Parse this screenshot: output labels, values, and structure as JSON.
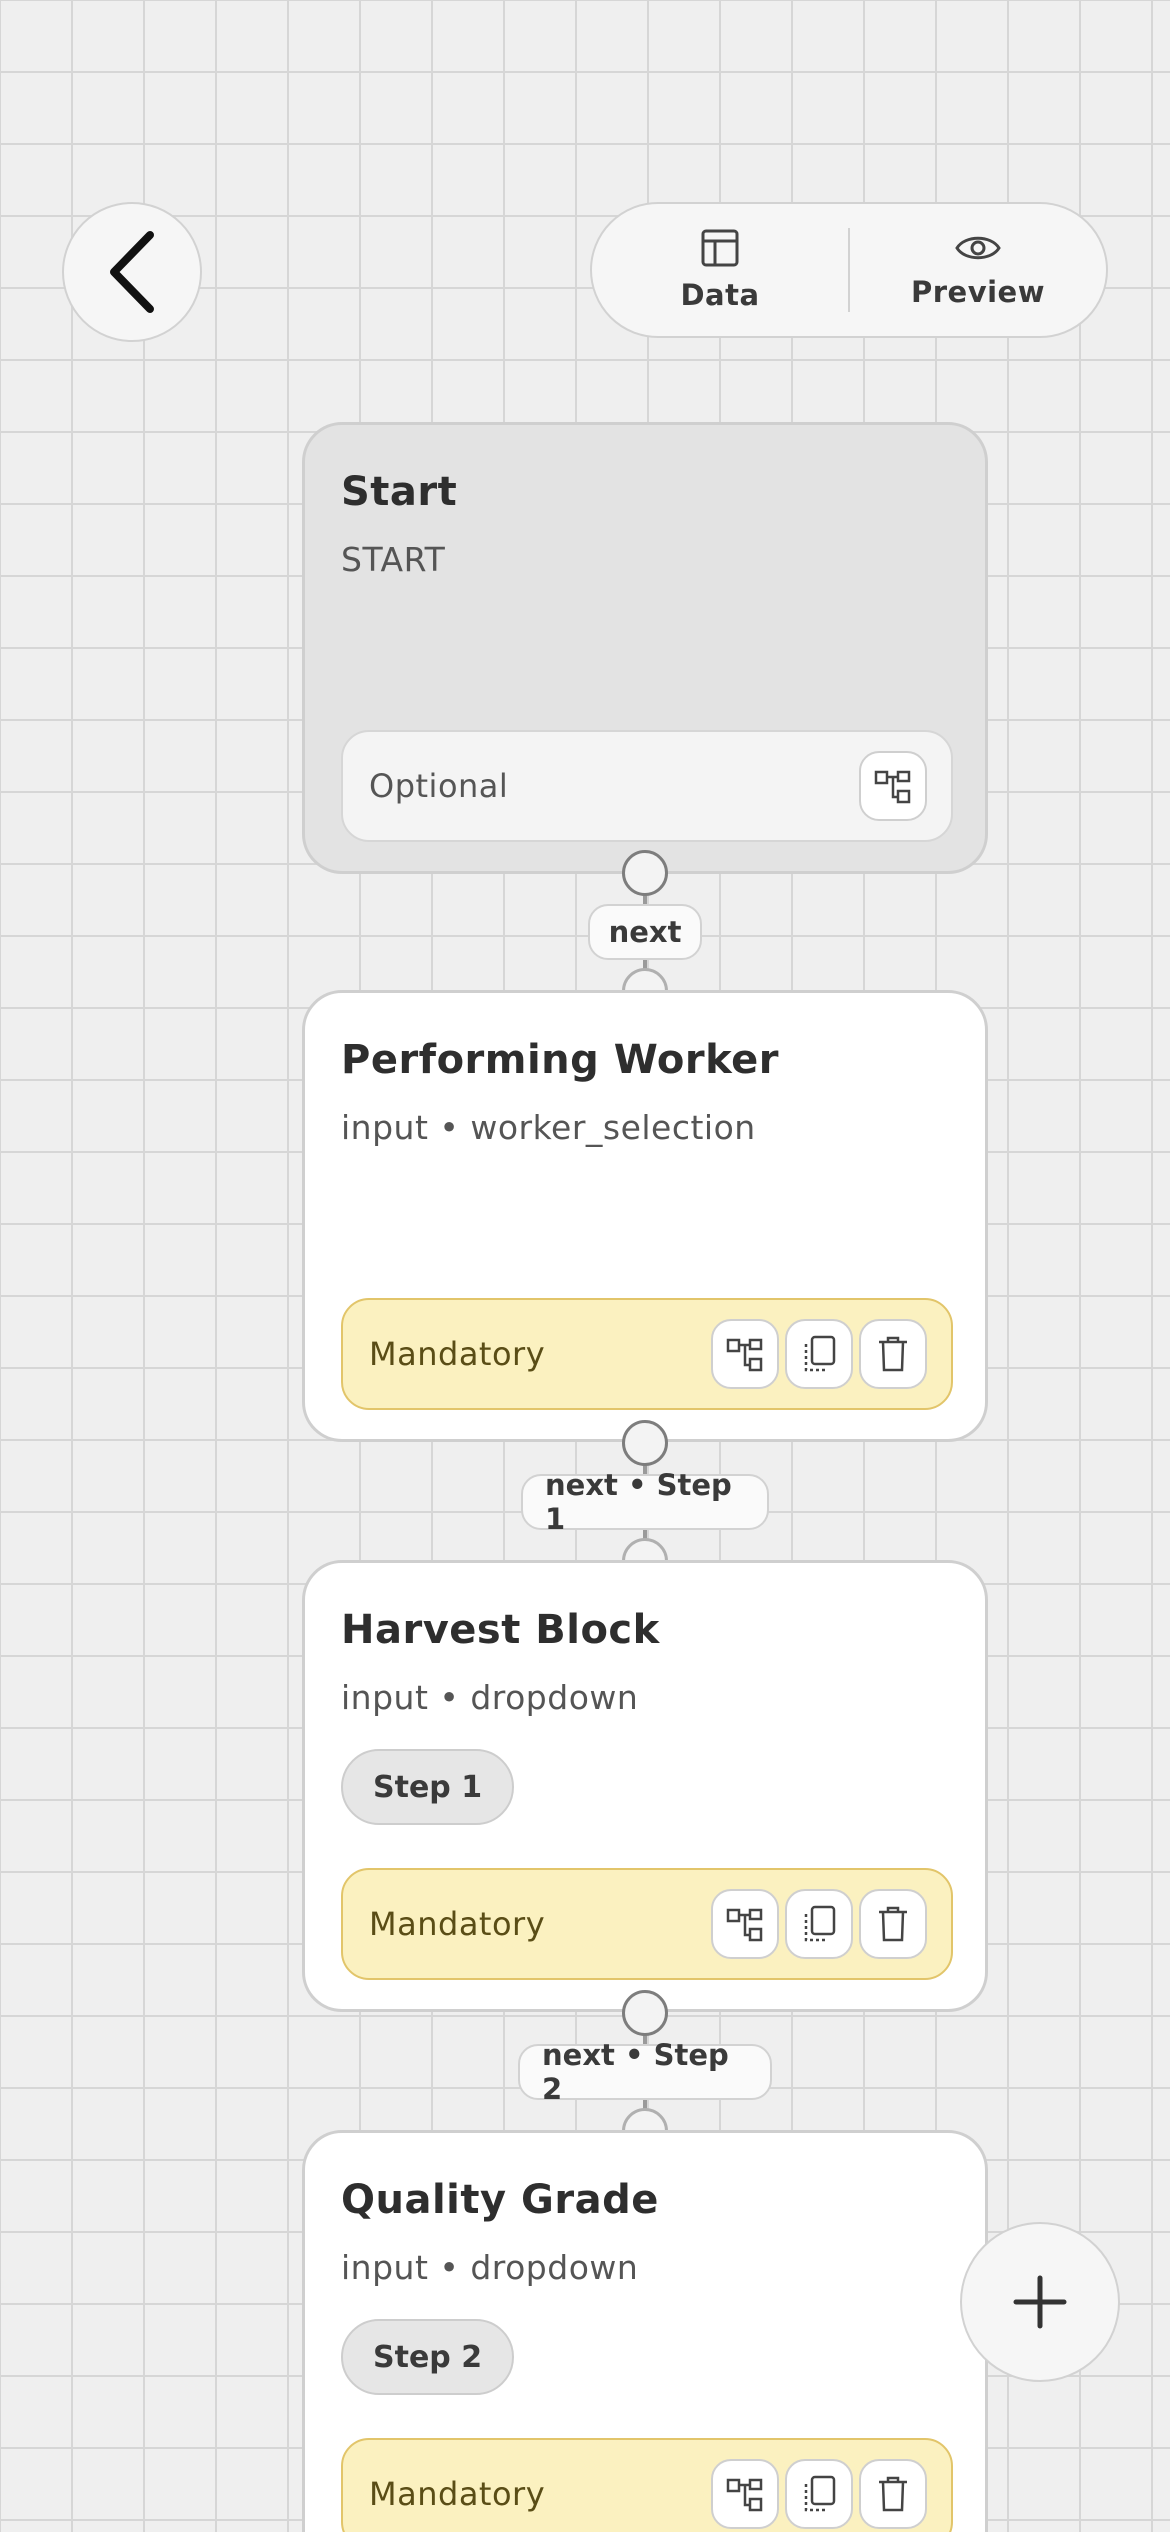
{
  "header": {
    "back_icon": "chevron-left-icon",
    "tabs": [
      {
        "label": "Data",
        "icon": "table-icon"
      },
      {
        "label": "Preview",
        "icon": "eye-icon"
      }
    ]
  },
  "nodes": [
    {
      "title": "Start",
      "subtitle": "START",
      "requirement": "Optional"
    },
    {
      "title": "Performing Worker",
      "subtitle": "input • worker_selection",
      "requirement": "Mandatory"
    },
    {
      "title": "Harvest Block",
      "subtitle": "input • dropdown",
      "chip": "Step 1",
      "requirement": "Mandatory"
    },
    {
      "title": "Quality Grade",
      "subtitle": "input • dropdown",
      "chip": "Step 2",
      "requirement": "Mandatory"
    }
  ],
  "edges": [
    {
      "label": "next"
    },
    {
      "label": "next • Step 1"
    },
    {
      "label": "next • Step 2"
    }
  ],
  "fab": {
    "icon": "plus-icon"
  },
  "colors": {
    "mandatory_bg": "#fbf1c0",
    "mandatory_border": "#e2c56a",
    "start_bg": "#e3e3e3",
    "grid_line": "#d6d6d6"
  }
}
